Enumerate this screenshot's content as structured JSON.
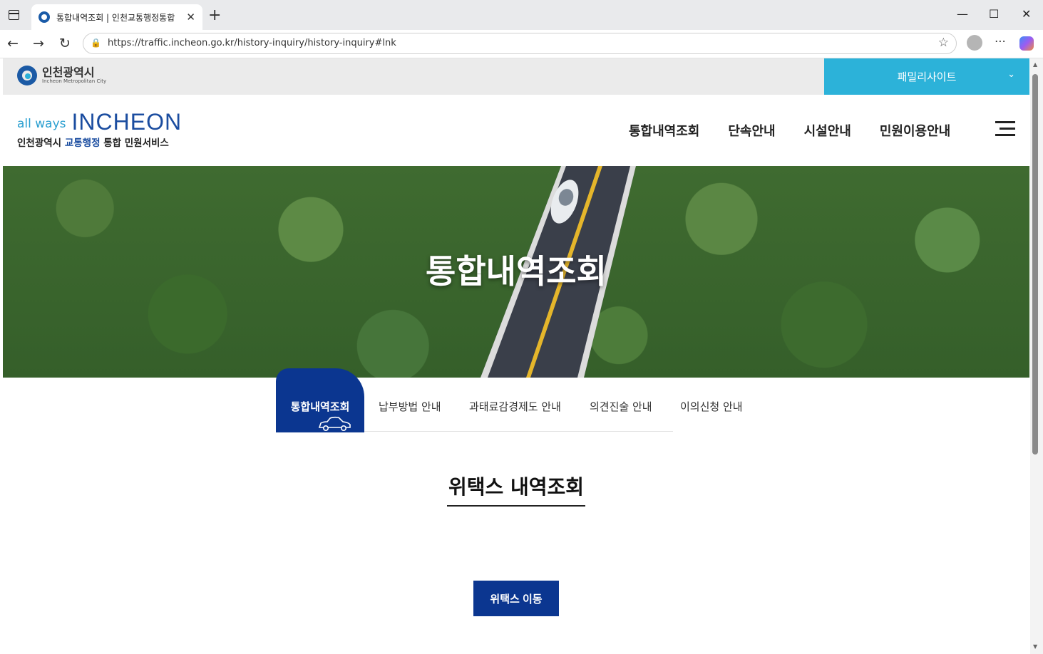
{
  "browser": {
    "tab_title": "통합내역조회 | 인천교통행정통합",
    "url": "https://traffic.incheon.go.kr/history-inquiry/history-inquiry#lnk",
    "new_tab_glyph": "+",
    "tab_close_glyph": "✕"
  },
  "top_strip": {
    "city_name": "인천광역시",
    "city_name_en": "Incheon Metropolitan City",
    "family_site": "패밀리사이트"
  },
  "header": {
    "brand_allways": "all ways",
    "brand_incheon": "INCHEON",
    "brand_sub_pre": "인천광역시 ",
    "brand_sub_hl": "교통행정",
    "brand_sub_post": " 통합 민원서비스",
    "gnb": [
      "통합내역조회",
      "단속안내",
      "시설안내",
      "민원이용안내"
    ]
  },
  "hero": {
    "title": "통합내역조회"
  },
  "subnav": {
    "active": "통합내역조회",
    "items": [
      "납부방법 안내",
      "과태료감경제도 안내",
      "의견진술 안내",
      "이의신청 안내"
    ]
  },
  "content": {
    "section_title": "위택스 내역조회",
    "wetax_button": "위택스 이동"
  },
  "colors": {
    "brand_navy": "#0b3690",
    "family_cyan": "#2cb2d9",
    "brand_blue": "#1b4da0"
  }
}
